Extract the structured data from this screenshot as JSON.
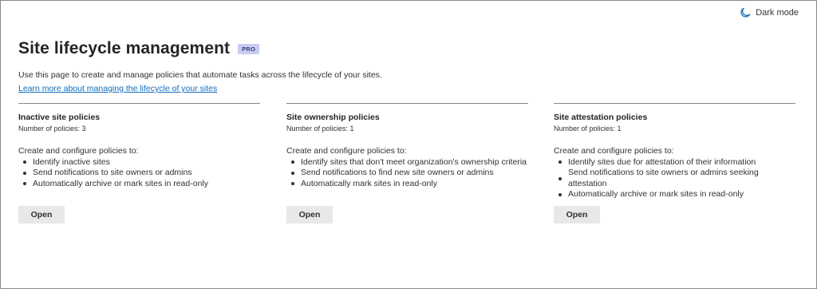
{
  "top_bar": {
    "dark_mode_label": "Dark mode",
    "dark_mode_icon": "moon-icon"
  },
  "header": {
    "title": "Site lifecycle management",
    "badge": "PRO",
    "description": "Use this page to create and manage policies that automate tasks across the lifecycle of your sites.",
    "learn_more_link": "Learn more about managing the lifecycle of your sites"
  },
  "cards": [
    {
      "title": "Inactive site policies",
      "count": "Number of policies: 3",
      "intro": "Create and configure policies to:",
      "items": [
        "Identify inactive sites",
        "Send notifications to site owners or admins",
        "Automatically archive or mark sites in read-only"
      ],
      "button": "Open"
    },
    {
      "title": "Site ownership policies",
      "count": "Number of policies: 1",
      "intro": "Create and configure policies to:",
      "items": [
        "Identify sites that don't meet organization's ownership criteria",
        "Send notifications to find new site owners or admins",
        "Automatically mark sites in read-only"
      ],
      "button": "Open"
    },
    {
      "title": "Site attestation policies",
      "count": "Number of policies: 1",
      "intro": "Create and configure policies to:",
      "items": [
        "Identify sites due for attestation of their information",
        "Send notifications to site owners or admins seeking attestation",
        "Automatically archive or mark sites in read-only"
      ],
      "button": "Open"
    }
  ],
  "colors": {
    "link": "#0f6cbd",
    "badge_bg": "#c7cdf5",
    "button_bg": "#e9e8e7",
    "divider": "#8a8886"
  }
}
